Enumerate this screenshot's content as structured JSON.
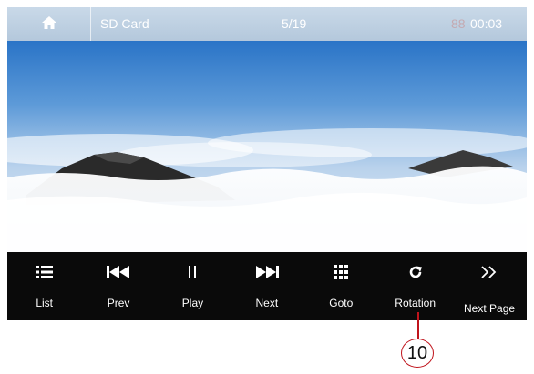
{
  "topbar": {
    "source": "SD Card",
    "counter": "5/19",
    "time": "00:03",
    "time_prefix": "88",
    "home_icon": "home-icon"
  },
  "photo": {
    "description_icon": "landscape-image"
  },
  "controls": [
    {
      "label": "List",
      "icon": "list-icon"
    },
    {
      "label": "Prev",
      "icon": "previous-icon"
    },
    {
      "label": "Play",
      "icon": "pause-icon"
    },
    {
      "label": "Next",
      "icon": "next-icon"
    },
    {
      "label": "Goto",
      "icon": "grid-icon"
    },
    {
      "label": "Rotation",
      "icon": "rotate-icon"
    },
    {
      "label": "Next Page",
      "icon": "double-chevron-right-icon"
    }
  ],
  "callout": {
    "number": "10",
    "color": "#c0141c"
  }
}
